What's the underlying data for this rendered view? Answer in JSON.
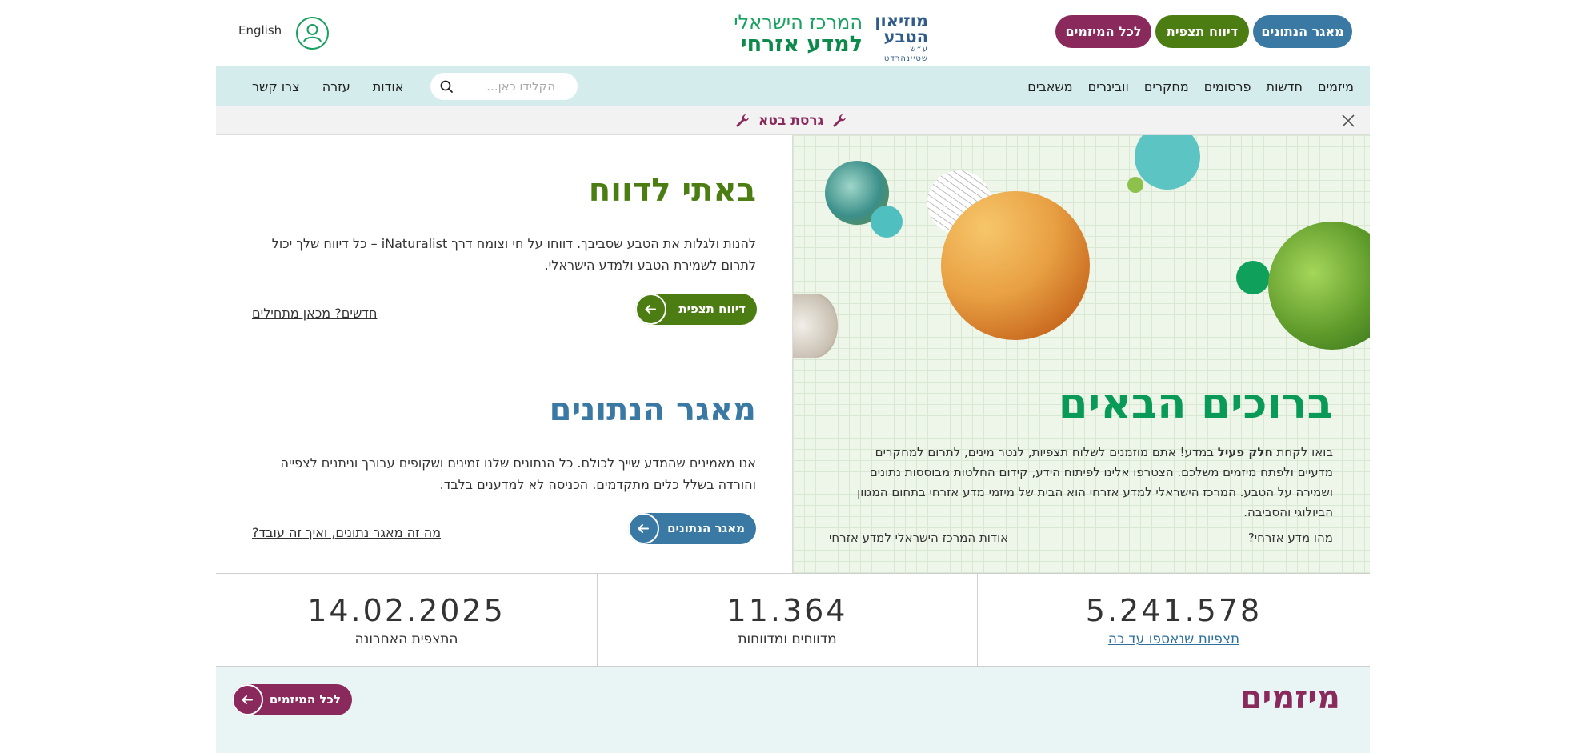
{
  "header": {
    "pill_buttons": {
      "database": "מאגר הנתונים",
      "report": "דיווח תצפית",
      "initiatives": "לכל המיזמים"
    },
    "logo_museum": {
      "line1": "מוזיאון",
      "line2": "הטבע",
      "sub": "ע״ש שטיינהרדט"
    },
    "logo_center": {
      "line1": "המרכז הישראלי",
      "line2": "למדע אזרחי"
    },
    "language_link": "English",
    "icons": {
      "user": "user-icon"
    }
  },
  "nav": {
    "items": [
      "מיזמים",
      "חדשות",
      "פרסומים",
      "מחקרים",
      "וובינרים",
      "משאבים"
    ],
    "search_placeholder": "הקלידו כאן...",
    "secondary": [
      "אודות",
      "עזרה",
      "צרו קשר"
    ],
    "icons": {
      "search": "search-icon"
    }
  },
  "beta_bar": {
    "label": "גרסת בטא",
    "icons": {
      "close": "close-icon",
      "wrench": "wrench-icon"
    }
  },
  "hero": {
    "title": "ברוכים הבאים",
    "text_before": "בואו לקחת ",
    "text_bold": "חלק פעיל",
    "text_after": " במדע! אתם מוזמנים לשלוח תצפיות, לנטר מינים, לתרום למחקרים מדעיים ולפתח מיזמים משלכם. הצטרפו אלינו לפיתוח הידע, קידום החלטות מבוססות נתונים ושמירה על הטבע. המרכז הישראלי למדע אזרחי הוא הבית של מיזמי מדע אזרחי בתחום המגוון הביולוגי והסביבה.",
    "link_what": "מהו מדע אזרחי?",
    "link_about": "אודות המרכז הישראלי למדע אזרחי"
  },
  "report_card": {
    "title": "באתי לדווח",
    "text": "להנות ולגלות את הטבע שסביבך. דווחו על חי וצומח דרך iNaturalist – כל דיווח שלך יכול לתרום לשמירת הטבע ולמדע הישראלי.",
    "button": "דיווח תצפית",
    "link": "חדשים? מכאן מתחילים"
  },
  "db_card": {
    "title": "מאגר הנתונים",
    "text": "אנו מאמינים שהמדע שייך לכולם. כל הנתונים שלנו זמינים ושקופים עבורך וניתנים לצפייה והורדה בשלל כלים מתקדמים. הכניסה לא למדענים בלבד.",
    "button": "מאגר הנתונים",
    "link": "מה זה מאגר נתונים, ואיך זה עובד?"
  },
  "stats": [
    {
      "value": "5.241.578",
      "label": "תצפיות שנאספו עד כה"
    },
    {
      "value": "11.364",
      "label": "מדווחים ומדווחות"
    },
    {
      "value": "14.02.2025",
      "label": "התצפית האחרונה"
    }
  ],
  "initiatives": {
    "title": "מיזמים",
    "button": "לכל המיזמים"
  },
  "colors": {
    "brand_green": "#0a9a58",
    "report_green": "#4c7d12",
    "data_blue": "#3a79a3",
    "initiatives_purple": "#8a2a5c",
    "nav_bg": "#d5ecec"
  }
}
